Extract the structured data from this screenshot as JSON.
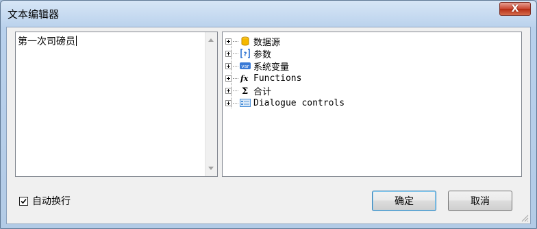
{
  "window": {
    "title": "文本编辑器",
    "close_label": "X"
  },
  "editor": {
    "text": "第一次司磅员"
  },
  "tree": {
    "items": [
      {
        "label": "数据源",
        "icon": "database-icon",
        "color": "#f0b400"
      },
      {
        "label": "参数",
        "icon": "parameter-icon",
        "color": "#2a6fd0"
      },
      {
        "label": "系统变量",
        "icon": "variable-icon",
        "color": "#3a7ad6"
      },
      {
        "label": "Functions",
        "icon": "function-icon",
        "color": "#000000"
      },
      {
        "label": "合计",
        "icon": "sum-icon",
        "color": "#000000"
      },
      {
        "label": "Dialogue controls",
        "icon": "form-icon",
        "color": "#4a90d9"
      }
    ]
  },
  "footer": {
    "wrap_label": "自动换行",
    "wrap_checked": true,
    "ok_label": "确定",
    "cancel_label": "取消"
  }
}
